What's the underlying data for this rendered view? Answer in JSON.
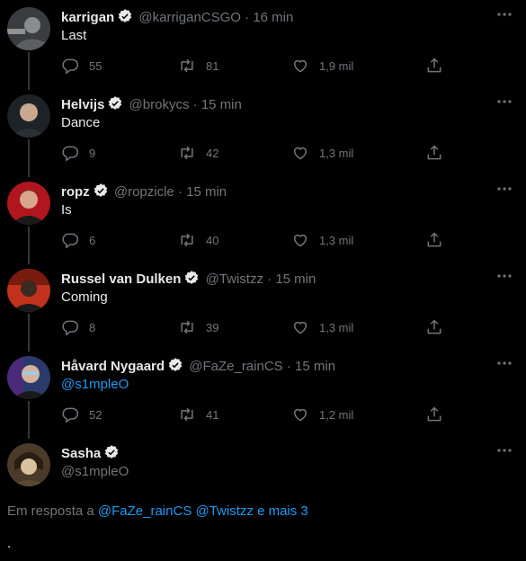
{
  "tweets": [
    {
      "name": "karrigan",
      "handle": "@karriganCSGO",
      "sep": "·",
      "time": "16 min",
      "text": "Last",
      "replies": "55",
      "retweets": "81",
      "likes": "1,9 mil"
    },
    {
      "name": "Helvijs",
      "handle": "@brokycs",
      "sep": "·",
      "time": "15 min",
      "text": "Dance",
      "replies": "9",
      "retweets": "42",
      "likes": "1,3 mil"
    },
    {
      "name": "ropz",
      "handle": "@ropzicle",
      "sep": "·",
      "time": "15 min",
      "text": "Is",
      "replies": "6",
      "retweets": "40",
      "likes": "1,3 mil"
    },
    {
      "name": "Russel van Dulken",
      "handle": "@Twistzz",
      "sep": "·",
      "time": "15 min",
      "text": "Coming",
      "replies": "8",
      "retweets": "39",
      "likes": "1,3 mil"
    },
    {
      "name": "Håvard Nygaard",
      "handle": "@FaZe_rainCS",
      "sep": "·",
      "time": "15 min",
      "text": "@s1mpleO",
      "replies": "52",
      "retweets": "41",
      "likes": "1,2 mil"
    }
  ],
  "main_tweet": {
    "name": "Sasha",
    "handle": "@s1mpleO",
    "reply_prefix": "Em resposta a",
    "mention_1": "@FaZe_rainCS",
    "mention_2": "@Twistzz",
    "and_more": "e mais 3",
    "text": "."
  },
  "colors": {
    "background": "#000000",
    "text": "#e7e9ea",
    "secondary": "#71767b",
    "link": "#1d9bf0",
    "thread_line": "#333639"
  },
  "icons": [
    "reply-icon",
    "retweet-icon",
    "like-icon",
    "share-icon",
    "more-icon",
    "verified-icon"
  ]
}
